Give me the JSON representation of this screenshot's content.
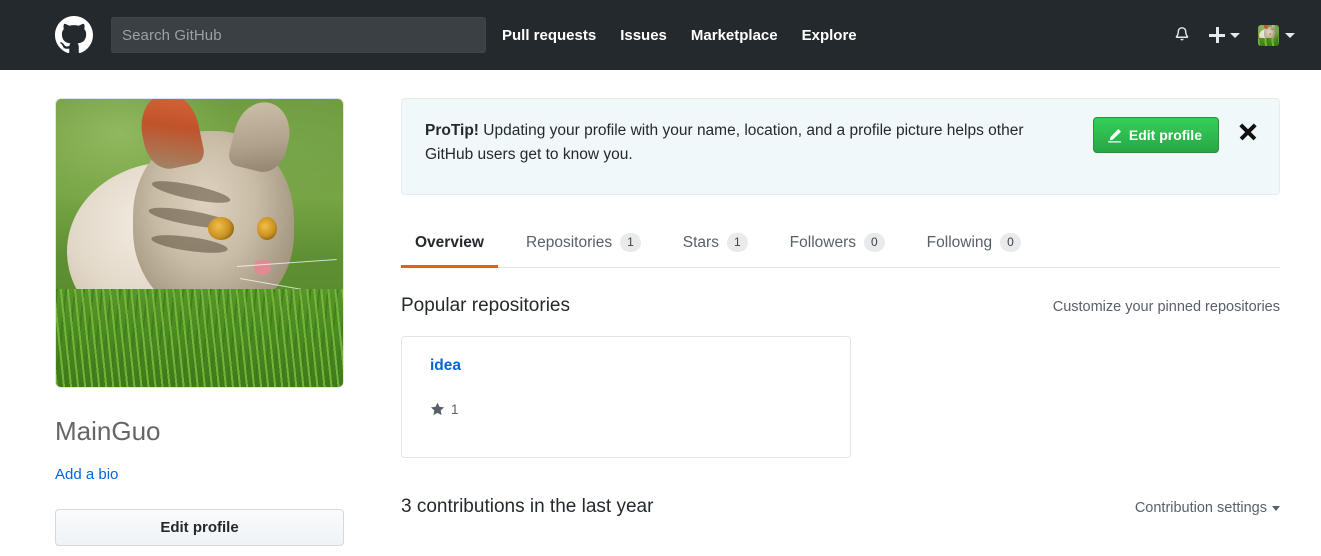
{
  "header": {
    "logo_icon": "github-octocat-logo",
    "search": {
      "placeholder": "Search GitHub",
      "value": ""
    },
    "nav": [
      {
        "label": "Pull requests"
      },
      {
        "label": "Issues"
      },
      {
        "label": "Marketplace"
      },
      {
        "label": "Explore"
      }
    ],
    "notifications_icon": "bell-icon",
    "create_new_icon": "plus-icon",
    "avatar_icon": "user-avatar-kitten",
    "background_color": "#24292e"
  },
  "sidebar": {
    "avatar_alt": "kitten-profile-photo",
    "username": "MainGuo",
    "bio_link": "Add a bio",
    "edit_profile_button": "Edit profile"
  },
  "protip": {
    "label": "ProTip!",
    "text": " Updating your profile with your name, location, and a profile picture helps other GitHub users get to know you.",
    "edit_button": "Edit profile",
    "edit_icon": "pencil-icon",
    "dismiss_icon": "close-icon",
    "accent_color": "#28a745",
    "background_color": "#f1f8fa"
  },
  "tabs": [
    {
      "label": "Overview",
      "count": "",
      "active": true
    },
    {
      "label": "Repositories",
      "count": "1",
      "active": false
    },
    {
      "label": "Stars",
      "count": "1",
      "active": false
    },
    {
      "label": "Followers",
      "count": "0",
      "active": false
    },
    {
      "label": "Following",
      "count": "0",
      "active": false
    }
  ],
  "tabs_active_underline_color": "#e36209",
  "popular_repositories": {
    "title": "Popular repositories",
    "customize_link": "Customize your pinned repositories",
    "repos": [
      {
        "name": "idea",
        "stars": "1",
        "star_icon": "star-icon"
      }
    ]
  },
  "contributions": {
    "title": "3 contributions in the last year",
    "settings_link": "Contribution settings",
    "settings_caret_icon": "chevron-down-icon"
  }
}
